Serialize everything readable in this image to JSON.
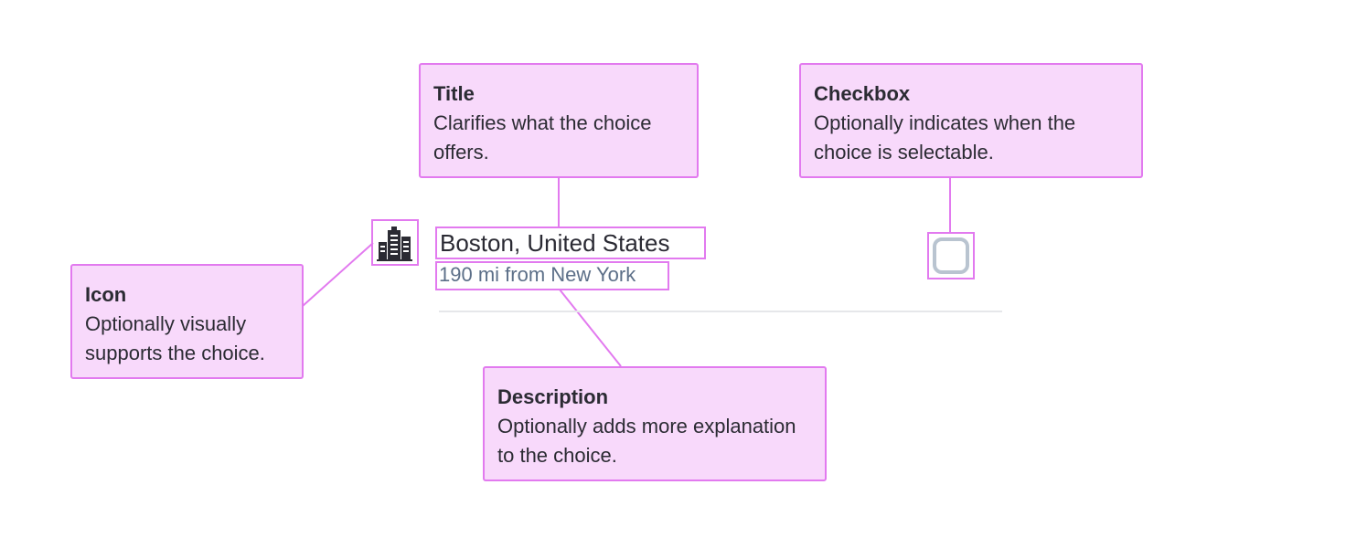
{
  "callouts": {
    "title": {
      "heading": "Title",
      "text": "Clarifies what the choice offers."
    },
    "checkbox": {
      "heading": "Checkbox",
      "text": "Optionally indicates when the choice is selectable."
    },
    "icon": {
      "heading": "Icon",
      "text": "Optionally visually supports the choice."
    },
    "description": {
      "heading": "Description",
      "text": "Optionally adds more explanation to the choice."
    }
  },
  "choice": {
    "title": "Boston, United States",
    "description": "190 mi from New York",
    "icon": "city-buildings-icon",
    "checked": false
  },
  "colors": {
    "callout_fill": "#f8d9fb",
    "callout_border": "#e27aef",
    "description_text": "#5c6f88",
    "checkbox_border": "#b9c4d0"
  }
}
